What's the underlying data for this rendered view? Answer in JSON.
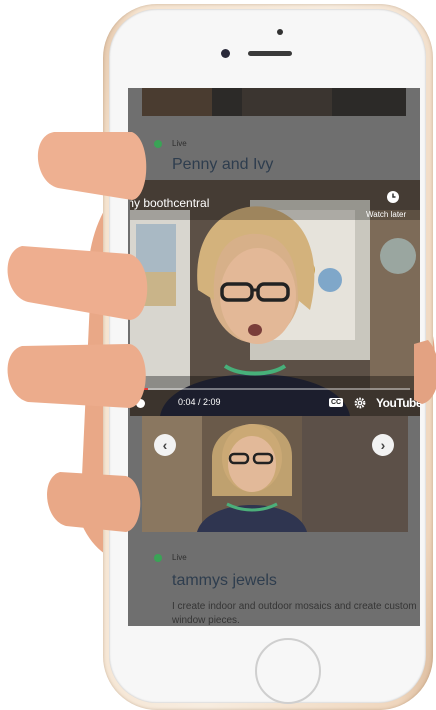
{
  "listing_top": {
    "status_label": "Live",
    "store_name": "Penny and Ivy"
  },
  "video": {
    "channel_title": "my boothcentral",
    "watch_later_label": "Watch later",
    "time_display": "0:04 / 2:09",
    "progress_fraction": 0.03,
    "captions_label": "CC",
    "brand_label": "YouTube"
  },
  "listing_bottom": {
    "status_label": "Live",
    "store_name": "tammys jewels",
    "description": "I create indoor and outdoor mosaics and create custom window pieces."
  },
  "icons": {
    "prev": "chevron-left",
    "next": "chevron-right",
    "watch_later": "clock",
    "captions": "cc",
    "settings": "gear"
  },
  "colors": {
    "live": "#3aa356",
    "store_name": "#2e3d4e",
    "phone_gold": "#f5e3cf"
  }
}
